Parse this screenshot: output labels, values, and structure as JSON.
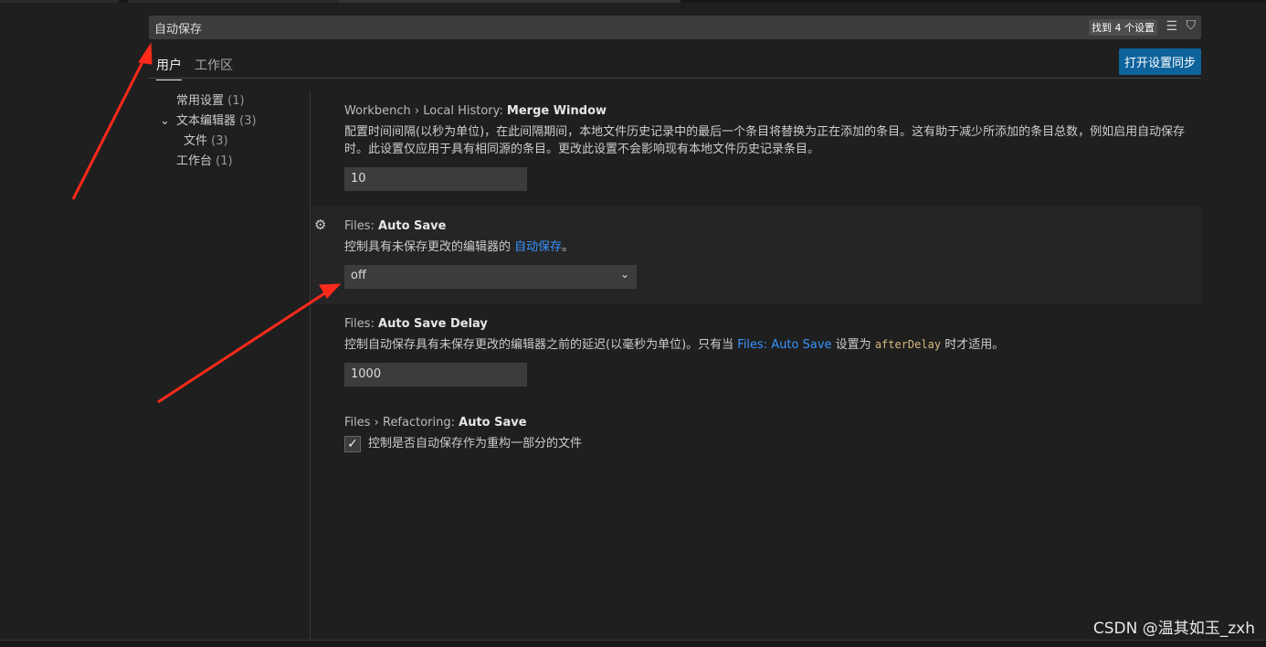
{
  "search": {
    "value": "自动保存",
    "result_count": "找到 4 个设置",
    "clear_icon": "clear-filter-icon",
    "filter_icon": "filter-icon"
  },
  "tabs": [
    {
      "label": "用户",
      "active": true
    },
    {
      "label": "工作区",
      "active": false
    }
  ],
  "sync_button": "打开设置同步",
  "toc": [
    {
      "label": "常用设置",
      "count": "(1)"
    },
    {
      "label": "文本编辑器",
      "count": "(3)",
      "expanded": true
    },
    {
      "label": "文件",
      "count": "(3)"
    },
    {
      "label": "工作台",
      "count": "(1)"
    }
  ],
  "settings": [
    {
      "prefix": "Workbench › Local History: ",
      "name": "Merge Window",
      "desc": "配置时间间隔(以秒为单位)，在此间隔期间，本地文件历史记录中的最后一个条目将替换为正在添加的条目。这有助于减少所添加的条目总数，例如启用自动保存时。此设置仅应用于具有相同源的条目。更改此设置不会影响现有本地文件历史记录条目。",
      "value": "10"
    },
    {
      "prefix": "Files: ",
      "name": "Auto Save",
      "desc": "控制具有未保存更改的编辑器的 ",
      "link": "自动保存",
      "desc_end": "。",
      "value": "off"
    },
    {
      "prefix": "Files: ",
      "name": "Auto Save Delay",
      "desc": "控制自动保存具有未保存更改的编辑器之前的延迟(以毫秒为单位)。只有当 ",
      "link": "Files: Auto Save",
      "desc_mid": " 设置为 ",
      "code": "afterDelay",
      "desc_end": " 时才适用。",
      "value": "1000"
    },
    {
      "prefix": "Files › Refactoring: ",
      "name": "Auto Save",
      "desc": "控制是否自动保存作为重构一部分的文件",
      "checked": true
    }
  ],
  "watermark": "CSDN @温其如玉_zxh",
  "colors": {
    "accent": "#0e639c",
    "link": "#3794ff",
    "arrow": "#ff2a1a"
  }
}
